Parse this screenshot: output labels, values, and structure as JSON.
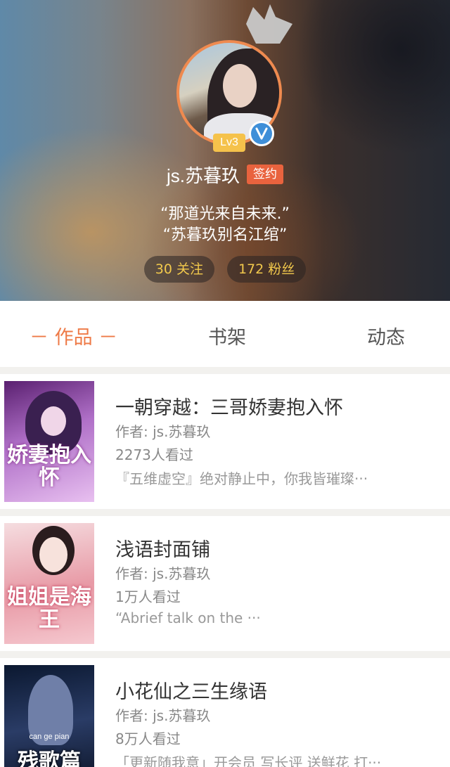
{
  "profile": {
    "username": "js.苏暮玖",
    "sign_badge": "签约",
    "level": "Lv3",
    "bio_line1": "“那道光来自未来.”",
    "bio_line2": "“苏暮玖别名江绾”",
    "following": "30 关注",
    "followers": "172 粉丝",
    "icons": [
      "crown-icon",
      "verified-icon"
    ]
  },
  "tabs": [
    {
      "label": "－ 作品 －",
      "active": true
    },
    {
      "label": "书架",
      "active": false
    },
    {
      "label": "动态",
      "active": false
    }
  ],
  "books": [
    {
      "title": "一朝穿越：三哥娇妻抱入怀",
      "author": "作者: js.苏暮玖",
      "views": "2273人看过",
      "desc": "『五维虚空』绝对静止中，你我皆璀璨···",
      "cover_text": "娇妻抱入怀"
    },
    {
      "title": "浅语封面铺",
      "author": "作者: js.苏暮玖",
      "views": "1万人看过",
      "desc": "“Abrief talk on the ···",
      "cover_text": "姐姐是海王"
    },
    {
      "title": "小花仙之三生缘语",
      "author": "作者: js.苏暮玖",
      "views": "8万人看过",
      "desc": "「更新随我意」开会员 写长评 送鲜花 打···",
      "cover_text": "残歌篇",
      "cover_subtext": "can ge pian"
    }
  ],
  "colors": {
    "accent": "#ee7a47",
    "sign_badge": "#e9633e",
    "level_badge": "#f5c24b",
    "verified": "#3f8fd8",
    "stat_text": "#f2c94c"
  }
}
